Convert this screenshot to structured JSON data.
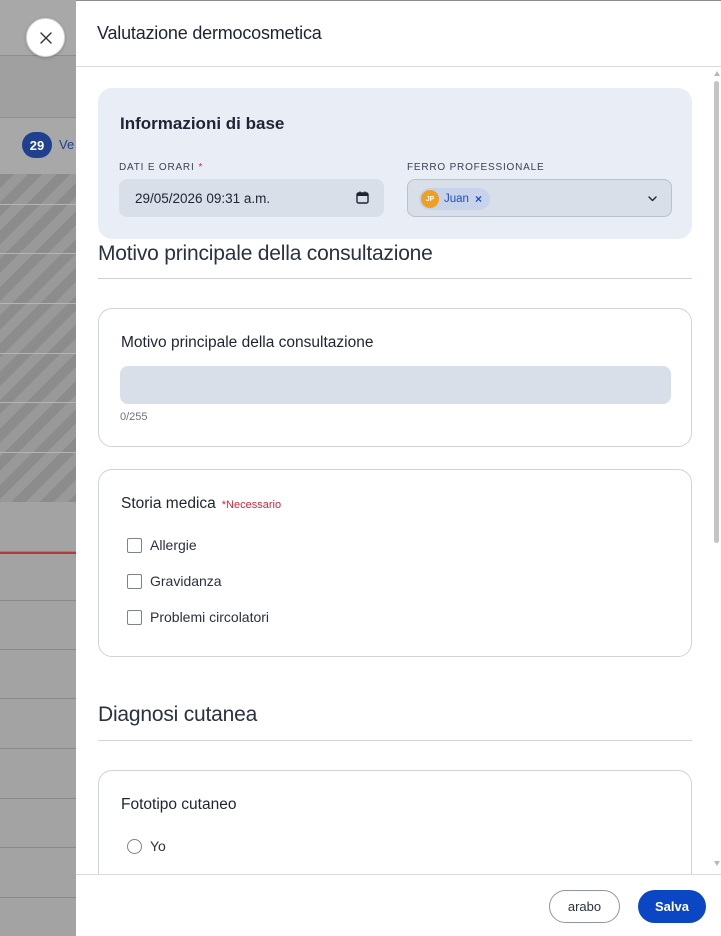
{
  "background": {
    "day_badge": "29",
    "day_label": "Ve"
  },
  "panel": {
    "title": "Valutazione dermocosmetica"
  },
  "base_info": {
    "title": "Informazioni di base",
    "date_label": "DATI E ORARI",
    "required_mark": "*",
    "date_value": "29/05/2026 09:31 a.m.",
    "pro_label": "FERRO PROFESSIONALE",
    "chip_initials": "JP",
    "chip_name": "Juan",
    "chip_remove": "×"
  },
  "section_consult": {
    "heading": "Motivo principale della consultazione",
    "card_title": "Motivo principale della consultazione",
    "counter": "0/255"
  },
  "medical_history": {
    "title": "Storia medica",
    "required": "*Necessario",
    "options": [
      "Allergie",
      "Gravidanza",
      "Problemi circolatori"
    ]
  },
  "section_skin": {
    "heading": "Diagnosi cutanea",
    "card_title": "Fototipo cutaneo",
    "options": [
      "Yo"
    ]
  },
  "footer": {
    "secondary_label": "arabo",
    "primary_label": "Salva"
  },
  "colors": {
    "primary": "#0b47c4",
    "required": "#d0253a",
    "card_bg": "#e9eef6",
    "field_bg": "#d9dfe8"
  }
}
